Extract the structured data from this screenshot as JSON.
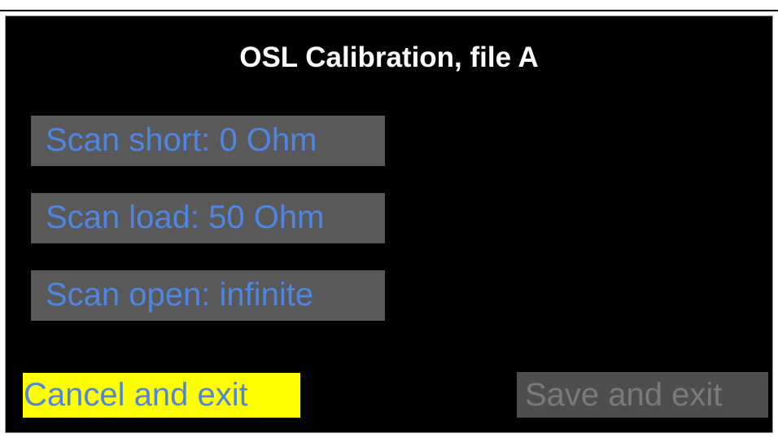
{
  "screen": {
    "title": "OSL Calibration, file A",
    "buttons": {
      "scan_short": "Scan short: 0 Ohm",
      "scan_load": "Scan load: 50 Ohm",
      "scan_open": "Scan open: infinite",
      "cancel": "Cancel and exit",
      "save": "Save and exit"
    },
    "save_enabled": false
  },
  "colors": {
    "background": "#000000",
    "title": "#ffffff",
    "button_text": "#4f86e4",
    "button_bg": "#595959",
    "cancel_bg": "#ffff00",
    "disabled_bg": "#4e4e4e",
    "disabled_text": "#7a7a7a"
  }
}
